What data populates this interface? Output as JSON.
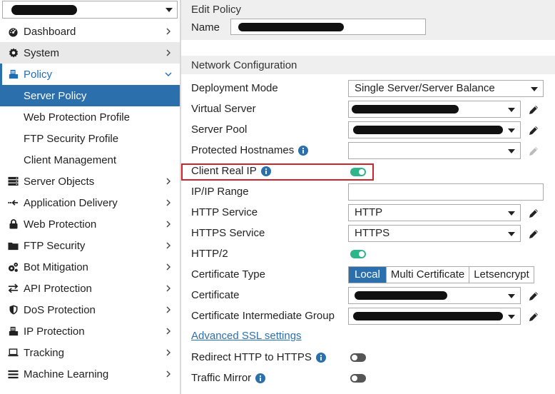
{
  "sidebar": {
    "vdom_value": "",
    "items": [
      {
        "label": "Dashboard",
        "icon": "dashboard-icon"
      },
      {
        "label": "System",
        "icon": "gear-icon"
      },
      {
        "label": "Policy",
        "icon": "policy-icon"
      },
      {
        "label": "Server Policy"
      },
      {
        "label": "Web Protection Profile"
      },
      {
        "label": "FTP Security Profile"
      },
      {
        "label": "Client Management"
      },
      {
        "label": "Server Objects",
        "icon": "server-icon"
      },
      {
        "label": "Application Delivery",
        "icon": "delivery-icon"
      },
      {
        "label": "Web Protection",
        "icon": "lock-icon"
      },
      {
        "label": "FTP Security",
        "icon": "folder-icon"
      },
      {
        "label": "Bot Mitigation",
        "icon": "bot-icon"
      },
      {
        "label": "API Protection",
        "icon": "arrows-icon"
      },
      {
        "label": "DoS Protection",
        "icon": "shield-icon"
      },
      {
        "label": "IP Protection",
        "icon": "ip-icon"
      },
      {
        "label": "Tracking",
        "icon": "laptop-icon"
      },
      {
        "label": "Machine Learning",
        "icon": "list-icon"
      }
    ]
  },
  "main": {
    "edit_header": "Edit Policy",
    "name_label": "Name",
    "network_header": "Network Configuration",
    "deployment_mode": {
      "label": "Deployment Mode",
      "value": "Single Server/Server Balance"
    },
    "virtual_server": {
      "label": "Virtual Server"
    },
    "server_pool": {
      "label": "Server Pool"
    },
    "protected_hostnames": {
      "label": "Protected Hostnames"
    },
    "client_real_ip": {
      "label": "Client Real IP",
      "enabled": true
    },
    "ip_range": {
      "label": "IP/IP Range"
    },
    "http_service": {
      "label": "HTTP Service",
      "value": "HTTP"
    },
    "https_service": {
      "label": "HTTPS Service",
      "value": "HTTPS"
    },
    "http2": {
      "label": "HTTP/2",
      "enabled": true
    },
    "certificate_type": {
      "label": "Certificate Type",
      "options": [
        "Local",
        "Multi Certificate",
        "Letsencrypt"
      ],
      "selected": "Local"
    },
    "certificate": {
      "label": "Certificate"
    },
    "cert_intermediate": {
      "label": "Certificate Intermediate Group"
    },
    "advanced_ssl_link": "Advanced SSL settings",
    "redirect_http": {
      "label": "Redirect HTTP to HTTPS",
      "enabled": false
    },
    "traffic_mirror": {
      "label": "Traffic Mirror",
      "enabled": false
    }
  },
  "colors": {
    "accent": "#2b6fad",
    "toggle_on": "#2fb58b",
    "highlight": "#d0242c",
    "section_bg": "#efefef"
  }
}
